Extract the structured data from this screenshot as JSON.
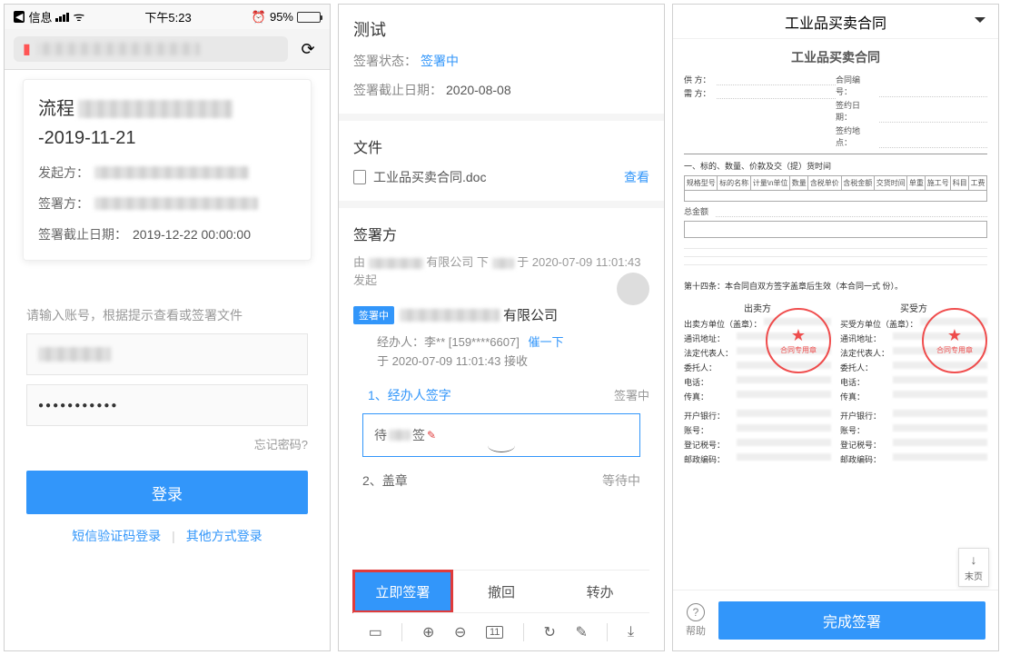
{
  "panel1": {
    "status": {
      "carrier_label": "信息",
      "time": "下午5:23",
      "battery_pct": "95%"
    },
    "flow": {
      "prefix": "流程",
      "suffix": "-2019-11-21",
      "originator_label": "发起方：",
      "signer_label": "签署方：",
      "deadline_label": "签署截止日期：",
      "deadline_value": "2019-12-22 00:00:00"
    },
    "login": {
      "hint": "请输入账号，根据提示查看或签署文件",
      "password_mask": "●●●●●●●●●●●",
      "forgot": "忘记密码?",
      "login_btn": "登录",
      "sms_login": "短信验证码登录",
      "other_login": "其他方式登录"
    }
  },
  "panel2": {
    "title": "测试",
    "status_label": "签署状态：",
    "status_value": "签署中",
    "deadline_label": "签署截止日期：",
    "deadline_value": "2020-08-08",
    "file_section": "文件",
    "file_name": "工业品买卖合同.doc",
    "view": "查看",
    "signer_section": "签署方",
    "from_text_prefix": "由",
    "from_text_mid": "有限公司 下",
    "from_text_suffix": "于 2020-07-09 11:01:43 发起",
    "tag": "签署中",
    "company_suffix": "有限公司",
    "handler_label": "经办人：",
    "handler_name": "李** [159****6607]",
    "remind": "催一下",
    "received": "于 2020-07-09 11:01:43 接收",
    "step1": "1、经办人签字",
    "step1_status": "签署中",
    "sign_placeholder_prefix": "待",
    "sign_placeholder_suffix": "签",
    "step2": "2、盖章",
    "step2_status": "等待中",
    "actions": {
      "sign": "立即签署",
      "revoke": "撤回",
      "forward": "转办"
    },
    "zoom_page": "11"
  },
  "panel3": {
    "header": "工业品买卖合同",
    "doc_title": "工业品买卖合同",
    "top": {
      "supplier_label": "供 方：",
      "buyer_label": "需 方：",
      "contract_no_label": "合同编号：",
      "sign_date_label": "签约日期：",
      "sign_place_label": "签约地点："
    },
    "sec1": "一、标的、数量、价款及交（提）货时间",
    "table_headers": [
      "规格型号",
      "标的名称",
      "计量\\n单位",
      "数量",
      "含税单价",
      "含税金额",
      "交货时间",
      "单重",
      "施工号",
      "科目",
      "工费"
    ],
    "total_label": "总金额",
    "clause14": "第十四条：本合同自双方签字盖章后生效（本合同一式 份）。",
    "seller_title": "出卖方",
    "buyer_title": "买受方",
    "party_fields": {
      "unit": "单位（盖章）：",
      "seller_unit": "出卖方单位（盖章）：",
      "buyer_unit": "买受方单位（盖章）：",
      "address": "通讯地址：",
      "legal": "法定代表人：",
      "agent": "委托人：",
      "phone": "电话：",
      "fax": "传真：",
      "bank": "开户银行：",
      "account": "账号：",
      "taxid": "登记税号：",
      "postcode": "邮政编码："
    },
    "seal_text": "合同专用章",
    "page_end": "末页",
    "help": "帮助",
    "finish": "完成签署"
  }
}
